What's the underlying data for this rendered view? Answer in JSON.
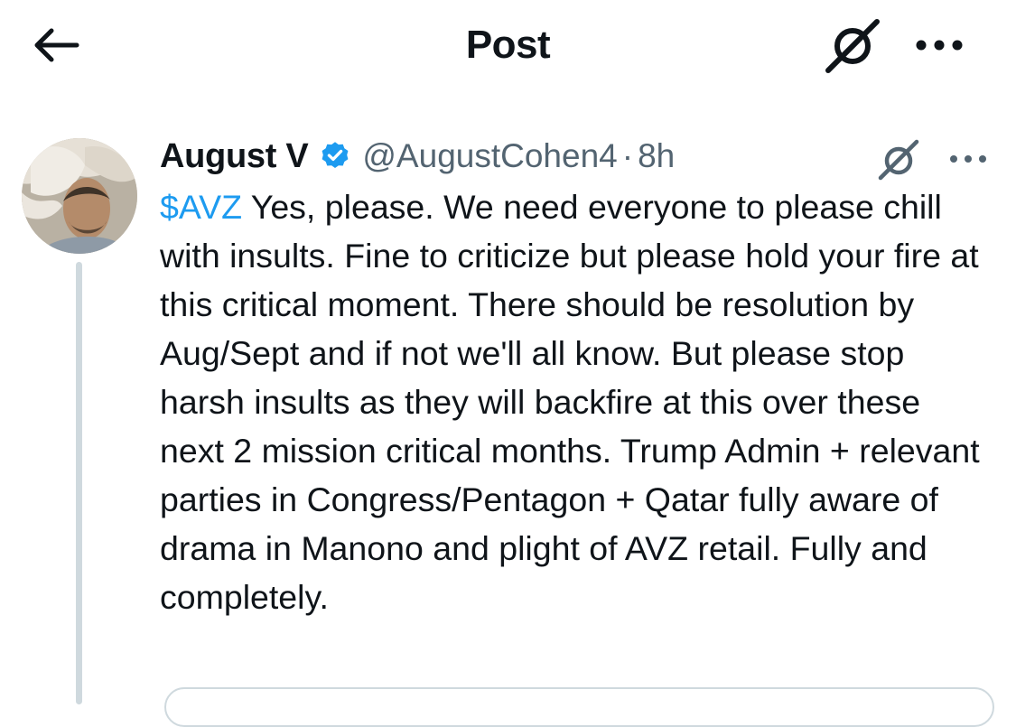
{
  "header": {
    "title": "Post",
    "back_icon": "arrow-left-icon",
    "grok_icon": "grok-icon",
    "more_icon": "more-horizontal-icon"
  },
  "post": {
    "author": {
      "display_name": "August V",
      "verified": true,
      "verified_color": "#1d9bf0",
      "handle": "@AugustCohen4",
      "separator": "·",
      "time": "8h"
    },
    "cashtag": "$AVZ",
    "text": " Yes, please. We need everyone to please chill with insults. Fine to criticize but please hold your fire at this critical moment. There should be resolution by Aug/Sept and if not we'll all know.  But please stop harsh insults as they will backfire at this over these next 2 mission critical months. Trump Admin + relevant parties in Congress/Pentagon + Qatar fully aware of drama in Manono and plight of AVZ retail. Fully and completely.",
    "link_color": "#1d9bf0"
  }
}
